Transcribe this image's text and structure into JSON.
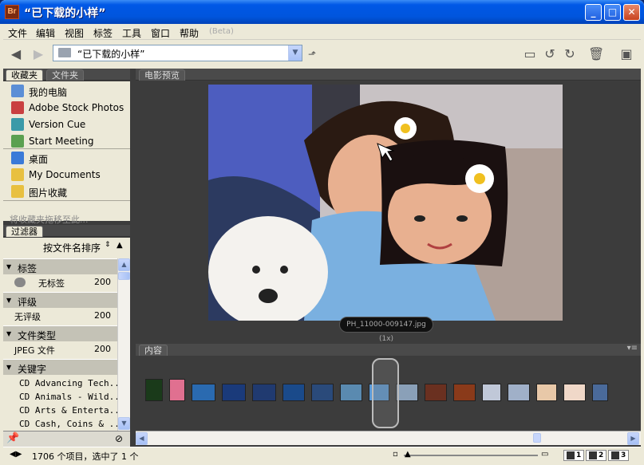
{
  "window": {
    "title": "“已下载的小样”",
    "app_icon": "Br"
  },
  "menu": [
    "文件",
    "编辑",
    "视图",
    "标签",
    "工具",
    "窗口",
    "帮助"
  ],
  "menu_beta": "(Beta)",
  "toolbar": {
    "path": "“已下载的小样”"
  },
  "tabs": {
    "favorites": "收藏夹",
    "folders": "文件夹",
    "preview": "电影预览",
    "filter": "过滤器",
    "content": "内容"
  },
  "favorites": [
    {
      "label": "我的电脑",
      "icon": "computer-icon",
      "color": "#5b8ed6"
    },
    {
      "label": "Adobe Stock Photos",
      "icon": "stock-photos-icon",
      "color": "#c94040"
    },
    {
      "label": "Version Cue",
      "icon": "version-cue-icon",
      "color": "#3a9aa8"
    },
    {
      "label": "Start Meeting",
      "icon": "meeting-icon",
      "color": "#5aa050"
    },
    {
      "label": "桌面",
      "icon": "desktop-icon",
      "color": "#3a7ad8"
    },
    {
      "label": "My Documents",
      "icon": "folder-icon",
      "color": "#e8c040"
    },
    {
      "label": "图片收藏",
      "icon": "folder-icon",
      "color": "#e8c040"
    }
  ],
  "favorites_hint": "将收藏夹拖移至此...",
  "filter": {
    "sort_label": "按文件名排序",
    "sections": [
      {
        "label": "标签",
        "rows": [
          {
            "label": "无标签",
            "count": "200"
          }
        ]
      },
      {
        "label": "评级",
        "rows": [
          {
            "label": "无评级",
            "count": "200"
          }
        ]
      },
      {
        "label": "文件类型",
        "rows": [
          {
            "label": "JPEG 文件",
            "count": "200"
          }
        ]
      },
      {
        "label": "关键字"
      }
    ],
    "keywords": [
      "CD Advancing Tech...",
      "CD Animals - Wild...",
      "CD Arts & Enterta...",
      "CD Cash, Coins & ..."
    ]
  },
  "preview": {
    "caption": "PH_11000-009147.jpg (1x)"
  },
  "status": {
    "text": "1706 个项目，选中了 1 个"
  },
  "view_buttons": [
    "1",
    "2",
    "3"
  ],
  "thumbs": [
    {
      "color": "#1a3a1a"
    },
    {
      "color": "#e07090"
    },
    {
      "color": "#2a6ab0"
    },
    {
      "color": "#1a3a7a"
    },
    {
      "color": "#203a70"
    },
    {
      "color": "#1a4a8a"
    },
    {
      "color": "#2a4a7a"
    },
    {
      "color": "#5a8ab0"
    },
    {
      "color": "#5a9ad8"
    },
    {
      "color": "#8aa0b8"
    },
    {
      "color": "#6a3020"
    },
    {
      "color": "#8a3a1a"
    },
    {
      "color": "#c0c8d8"
    },
    {
      "color": "#a0b0c8"
    },
    {
      "color": "#e8c8a8"
    },
    {
      "color": "#f0d8c8"
    },
    {
      "color": "#4a6a9a"
    }
  ]
}
